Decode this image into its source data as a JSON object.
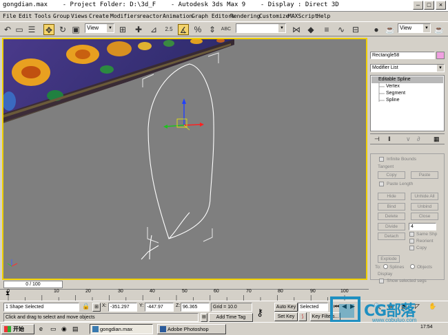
{
  "window": {
    "title": "gongdian.max    - Project Folder: D:\\3d_F    - Autodesk 3ds Max 9    - Display : Direct 3D"
  },
  "menu": [
    "File",
    "Edit",
    "Tools",
    "Group",
    "Views",
    "Create",
    "Modifiers",
    "reactor",
    "Animation",
    "Graph Editors",
    "Rendering",
    "Customize",
    "MAXScript",
    "Help"
  ],
  "toolbar": {
    "ref_coord": "View",
    "snap_value": "2.5",
    "selection_set": "",
    "render_preset": "View"
  },
  "viewport": {
    "label": ""
  },
  "command_panel": {
    "object_name": "Rectangle58",
    "modifier_list": "Modifier List",
    "stack": [
      "Editable Spline",
      "Vertex",
      "Segment",
      "Spline"
    ],
    "infinite_bounds": "Infinite Bounds",
    "tangent_group": "Tangent",
    "copy": "Copy",
    "paste": "Paste",
    "paste_length": "Paste Length",
    "hide": "Hide",
    "unhide_all": "Unhide All",
    "bind": "Bind",
    "unbind": "Unbind",
    "delete": "Delete",
    "close": "Close",
    "divide": "Divide",
    "divide_value": "4",
    "detach": "Detach",
    "same_shp": "Same Shp",
    "reorient": "Reorient",
    "copy_chk": "Copy",
    "explode": "Explode",
    "to_label": "To:",
    "splines": "Splines",
    "objects": "Objects",
    "display_group": "Display",
    "show_selected_segs": "Show selected segs"
  },
  "timeline": {
    "frame_display": "0 / 100",
    "ticks": [
      "0",
      "10",
      "20",
      "30",
      "40",
      "50",
      "60",
      "70",
      "80",
      "90",
      "100"
    ]
  },
  "status": {
    "selection": "1 Shape Selected",
    "prompt": "Click and drag to select and move objects",
    "x_label": "X:",
    "x": "-351.297",
    "y_label": "Y:",
    "y": "-447.97",
    "z_label": "Z:",
    "z": "96.365",
    "grid": "Grid = 10.0",
    "add_time_tag": "Add Time Tag",
    "auto_key": "Auto Key",
    "selected": "Selected",
    "set_key": "Set Key",
    "key_filters": "Key Filters..."
  },
  "taskbar": {
    "start": "开始",
    "tasks": [
      "gongdian.max",
      "Adobe Photoshop"
    ],
    "clock": "17:54"
  },
  "watermark": {
    "brand": "CG部落",
    "url": "www.cgbuluo.com"
  },
  "colors": {
    "viewport_bg": "#7f7f7f",
    "active_border": "#f0d000",
    "spline": "#ffffff",
    "selection": "#e8e8e8",
    "brand_blue": "#1f8fc0"
  }
}
